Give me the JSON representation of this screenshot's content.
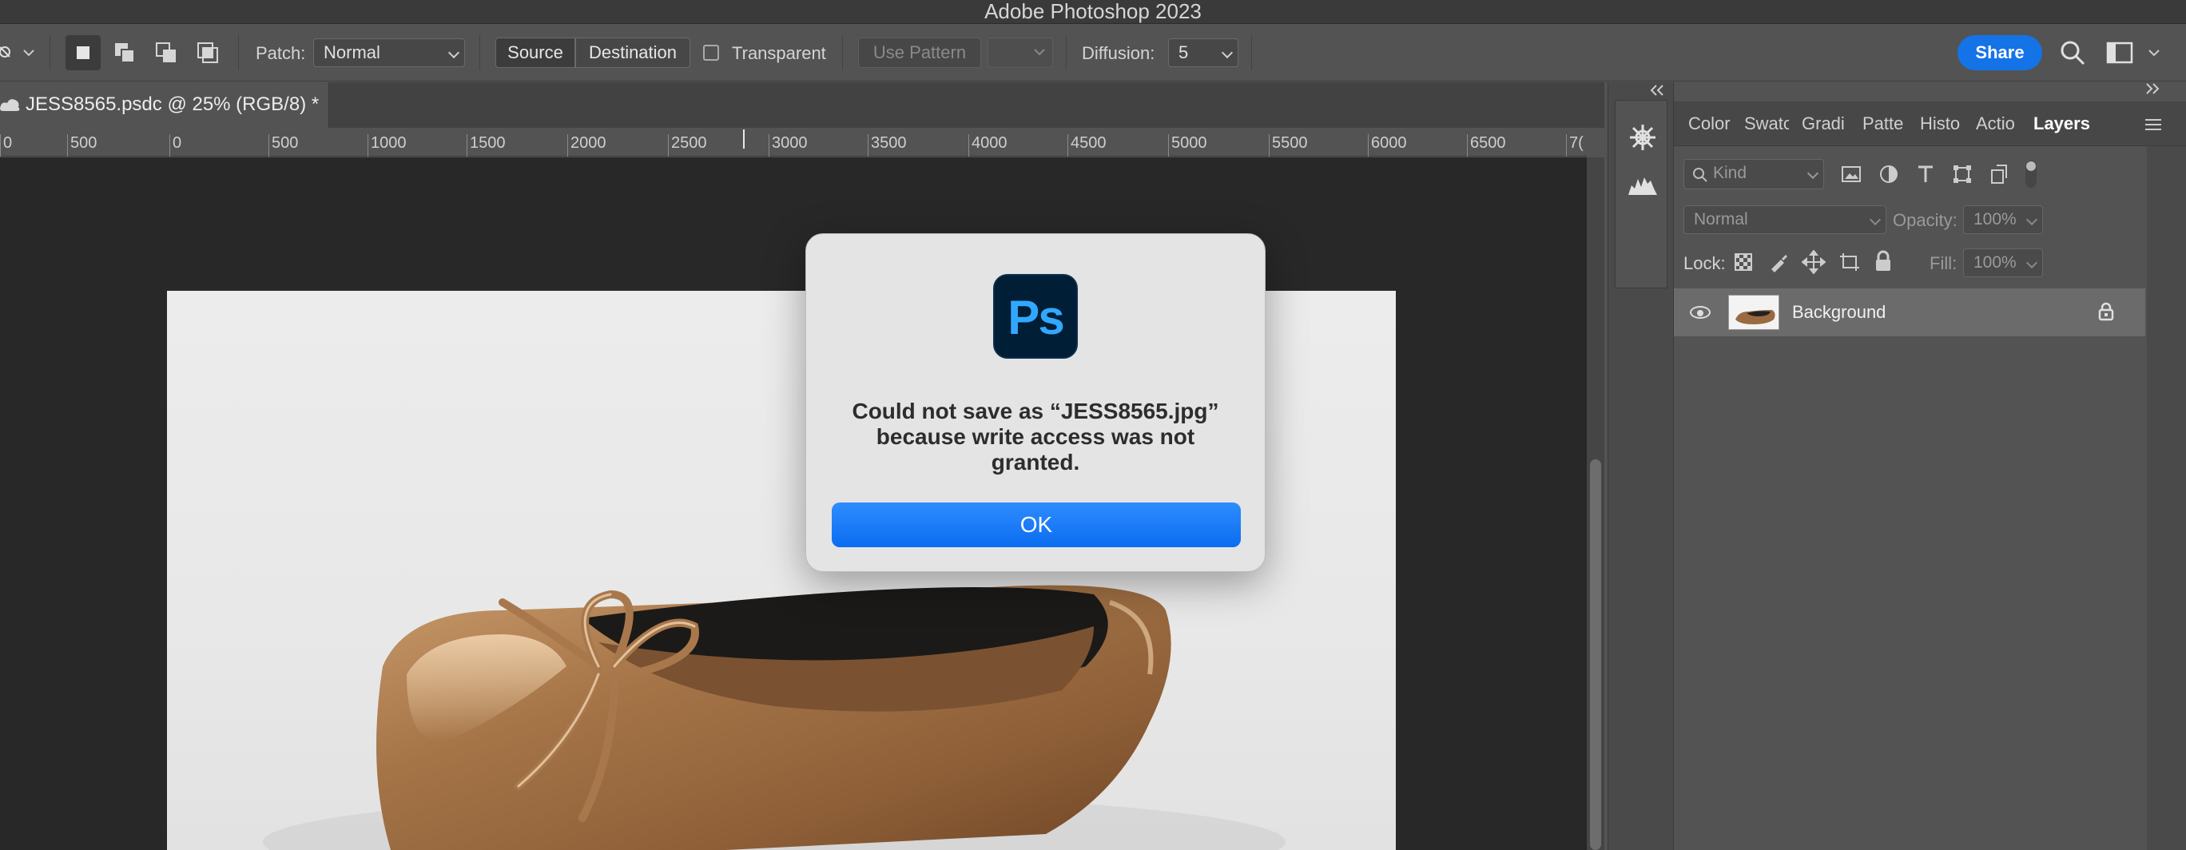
{
  "window": {
    "title": "Adobe Photoshop 2023"
  },
  "options_bar": {
    "patch_label": "Patch:",
    "patch_mode": "Normal",
    "source_label": "Source",
    "destination_label": "Destination",
    "transparent_label": "Transparent",
    "use_pattern_label": "Use Pattern",
    "diffusion_label": "Diffusion:",
    "diffusion_value": "5",
    "share_label": "Share"
  },
  "document": {
    "tab_title": "JESS8565.psdc @ 25% (RGB/8) *"
  },
  "ruler": {
    "ticks": [
      "0",
      "500",
      "0",
      "500",
      "1000",
      "1500",
      "2000",
      "2500",
      "3000",
      "3500",
      "4000",
      "4500",
      "5000",
      "5500",
      "6000",
      "6500",
      "7("
    ]
  },
  "dialog": {
    "message": "Could not save as “JESS8565.jpg” because write access was not granted.",
    "ok_label": "OK",
    "app_logo_text": "Ps"
  },
  "panels": {
    "tabs": [
      "Color",
      "Swatc",
      "Gradi",
      "Patte",
      "Histo",
      "Actio",
      "Layers"
    ],
    "active_tab": "Layers",
    "kind_placeholder": "Kind",
    "blend_mode": "Normal",
    "opacity_label": "Opacity:",
    "opacity_value": "100%",
    "lock_label": "Lock:",
    "fill_label": "Fill:",
    "fill_value": "100%",
    "layers": [
      {
        "name": "Background",
        "locked": true
      }
    ]
  },
  "colors": {
    "accent": "#1473e6",
    "ok_button": "#0a6df0",
    "ps_logo_bg": "#001e36",
    "ps_logo_text": "#31a8ff"
  }
}
